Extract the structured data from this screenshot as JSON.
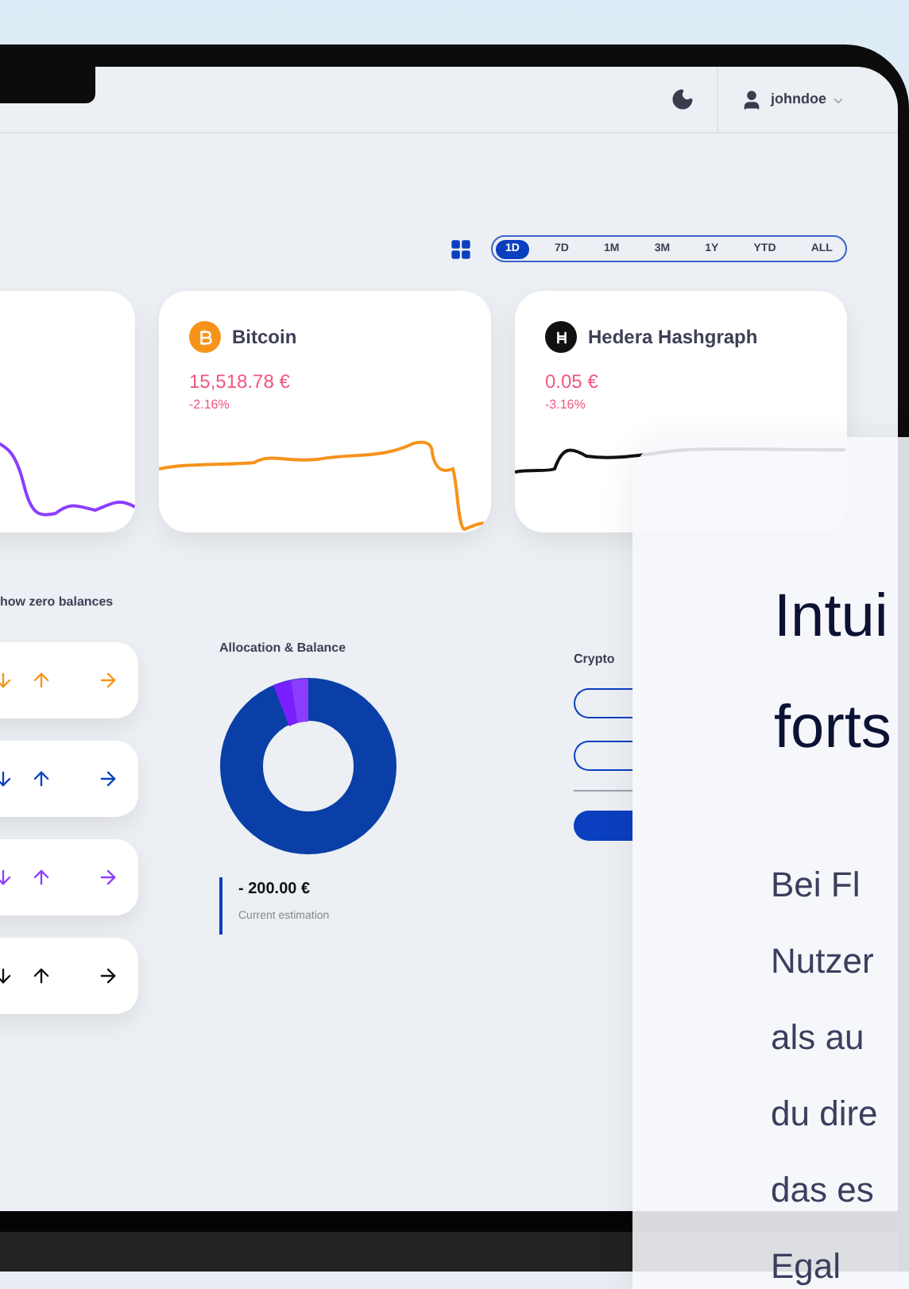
{
  "header": {
    "username": "johndoe"
  },
  "time_ranges": [
    {
      "label": "1D",
      "selected": true
    },
    {
      "label": "7D",
      "selected": false
    },
    {
      "label": "1M",
      "selected": false
    },
    {
      "label": "3M",
      "selected": false
    },
    {
      "label": "1Y",
      "selected": false
    },
    {
      "label": "YTD",
      "selected": false
    },
    {
      "label": "ALL",
      "selected": false
    }
  ],
  "asset_cards": [
    {
      "kind": "partial",
      "color": "#8b3dff"
    },
    {
      "kind": "bitcoin",
      "name": "Bitcoin",
      "price": "15,518.78 €",
      "change": "-2.16%",
      "color": "#f7931a"
    },
    {
      "kind": "hedera",
      "name": "Hedera Hashgraph",
      "price": "0.05 €",
      "change": "-3.16%",
      "color": "#111111"
    }
  ],
  "balances": {
    "toggle_label": "how zero balances",
    "rows": [
      {
        "color": "#f7931a"
      },
      {
        "color": "#0a3fbf"
      },
      {
        "color": "#8b3dff"
      },
      {
        "color": "#111111"
      }
    ]
  },
  "allocation": {
    "title": "Allocation & Balance",
    "amount": "- 200.00 €",
    "caption": "Current estimation"
  },
  "crypto": {
    "title": "Crypto"
  },
  "feature": {
    "heading_lines": [
      "Intui",
      "forts"
    ],
    "body_lines": [
      "Bei Fl",
      "Nutzer",
      "als au",
      "du dire",
      "das es",
      "Egal"
    ]
  }
}
